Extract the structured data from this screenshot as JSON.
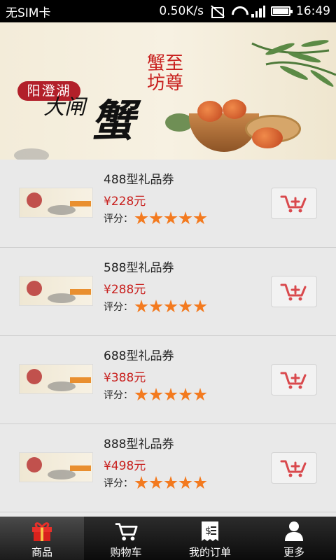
{
  "status_bar": {
    "carrier": "无SIM卡",
    "speed": "0.50K/s",
    "time": "16:49"
  },
  "banner": {
    "lake": "阳澄湖",
    "title_small": "大闸",
    "title_big": "蟹",
    "brand": "蟹至坊尊"
  },
  "products": [
    {
      "name": "488型礼品券",
      "price": "¥228元",
      "rating_label": "评分：",
      "stars": 5
    },
    {
      "name": "588型礼品券",
      "price": "¥288元",
      "rating_label": "评分：",
      "stars": 5
    },
    {
      "name": "688型礼品券",
      "price": "¥388元",
      "rating_label": "评分：",
      "stars": 5
    },
    {
      "name": "888型礼品券",
      "price": "¥498元",
      "rating_label": "评分：",
      "stars": 5
    }
  ],
  "tabbar": {
    "items": [
      {
        "label": "商品",
        "icon": "gift-icon",
        "active": true
      },
      {
        "label": "购物车",
        "icon": "cart-icon",
        "active": false
      },
      {
        "label": "我的订单",
        "icon": "receipt-icon",
        "active": false
      },
      {
        "label": "更多",
        "icon": "user-icon",
        "active": false
      }
    ]
  },
  "colors": {
    "price": "#c8201e",
    "star": "#f37a1f",
    "cart_icon": "#d9494d"
  }
}
